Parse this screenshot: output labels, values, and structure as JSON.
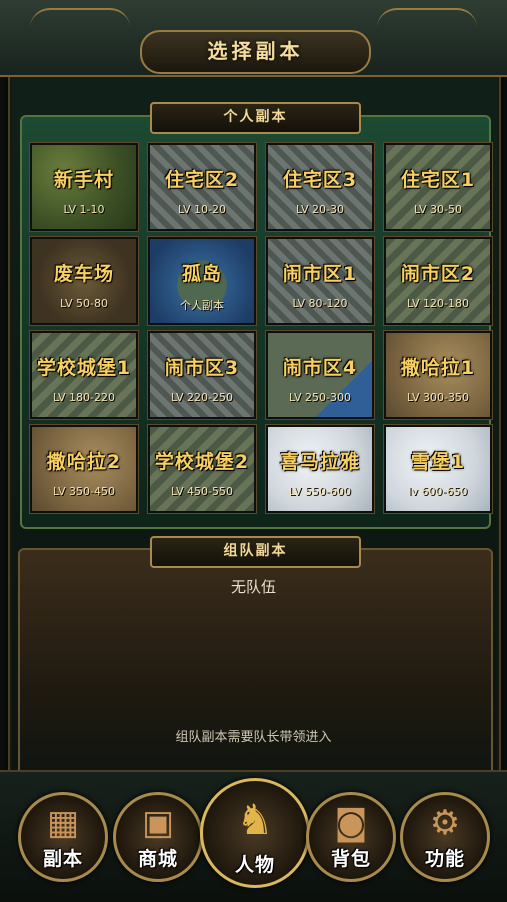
{
  "header": {
    "title": "选择副本"
  },
  "personal_section": {
    "title": "个人副本",
    "dungeons": [
      {
        "name": "新手村",
        "level": "LV 1-10",
        "terrain": "grass"
      },
      {
        "name": "住宅区2",
        "level": "LV 10-20",
        "terrain": "city"
      },
      {
        "name": "住宅区3",
        "level": "LV 20-30",
        "terrain": "city"
      },
      {
        "name": "住宅区1",
        "level": "LV 30-50",
        "terrain": "city2"
      },
      {
        "name": "废车场",
        "level": "LV 50-80",
        "terrain": "dark"
      },
      {
        "name": "孤岛",
        "level": "个人副本",
        "terrain": "island"
      },
      {
        "name": "闹市区1",
        "level": "LV 80-120",
        "terrain": "city"
      },
      {
        "name": "闹市区2",
        "level": "LV 120-180",
        "terrain": "city2"
      },
      {
        "name": "学校城堡1",
        "level": "LV 180-220",
        "terrain": "city2"
      },
      {
        "name": "闹市区3",
        "level": "LV 220-250",
        "terrain": "city"
      },
      {
        "name": "闹市区4",
        "level": "LV 250-300",
        "terrain": "water"
      },
      {
        "name": "撒哈拉1",
        "level": "LV 300-350",
        "terrain": "desert"
      },
      {
        "name": "撒哈拉2",
        "level": "LV 350-450",
        "terrain": "desert"
      },
      {
        "name": "学校城堡2",
        "level": "LV 450-550",
        "terrain": "city2"
      },
      {
        "name": "喜马拉雅",
        "level": "LV 550-600",
        "terrain": "snow"
      },
      {
        "name": "雪堡1",
        "level": "lv 600-650",
        "terrain": "snow"
      }
    ]
  },
  "team_section": {
    "title": "组队副本",
    "status": "无队伍",
    "hint": "组队副本需要队长带领进入"
  },
  "bottom_nav": [
    {
      "label": "副本",
      "icon": "dungeon-map-icon",
      "glyph": "▦"
    },
    {
      "label": "商城",
      "icon": "treasure-chest-icon",
      "glyph": "▣"
    },
    {
      "label": "人物",
      "icon": "character-helmet-icon",
      "glyph": "♞"
    },
    {
      "label": "背包",
      "icon": "backpack-icon",
      "glyph": "◙"
    },
    {
      "label": "功能",
      "icon": "gear-icon",
      "glyph": "⚙"
    }
  ],
  "colors": {
    "accent_gold": "#f8cf62",
    "border_gold": "#a88a4c",
    "panel_green": "#1d4a33"
  }
}
